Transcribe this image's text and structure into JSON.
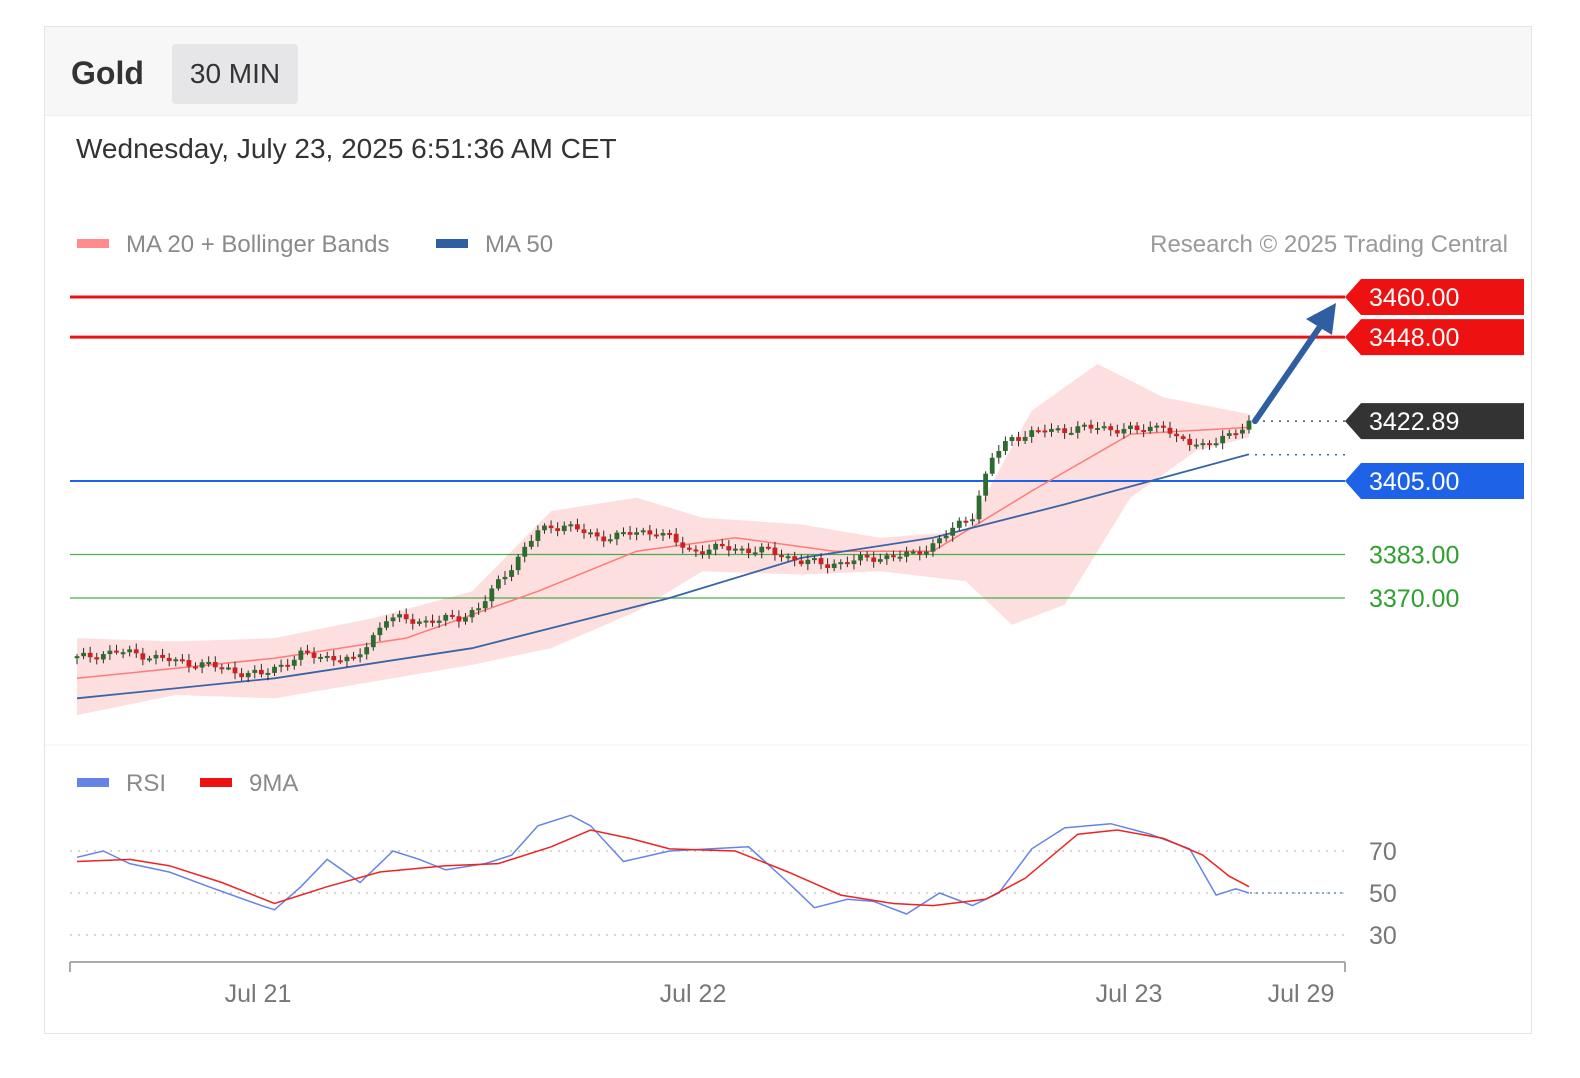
{
  "header": {
    "instrument": "Gold",
    "timeframe": "30 MIN",
    "datetime": "Wednesday, July 23, 2025 6:51:36 AM CET"
  },
  "legend": {
    "ma20_label": "MA 20 + Bollinger Bands",
    "ma50_label": "MA 50",
    "credit": "Research © 2025 Trading Central"
  },
  "rsi_legend": {
    "rsi_label": "RSI",
    "ma9_label": "9MA"
  },
  "colors": {
    "resistance": "#ee1111",
    "pivot": "#1e62e8",
    "support": "#2ea02e",
    "last": "#333333",
    "bullish": "#2e6b2e",
    "bearish": "#d11f1f",
    "ma20": "#ff7a7a",
    "bands": "#fdd9d9",
    "ma50": "#3a64a8",
    "rsi": "#6684e6",
    "rsi_ma": "#ee2222",
    "arrow": "#2f5ea1"
  },
  "chart_data": [
    {
      "type": "candlestick",
      "x_labels": [
        "Jul 21",
        "Jul 22",
        "Jul 23",
        "Jul 29"
      ],
      "ylim": [
        3345,
        3468
      ],
      "levels": [
        {
          "value": 3460.0,
          "label": "3460.00",
          "kind": "resistance"
        },
        {
          "value": 3448.0,
          "label": "3448.00",
          "kind": "resistance"
        },
        {
          "value": 3422.89,
          "label": "3422.89",
          "kind": "last"
        },
        {
          "value": 3405.0,
          "label": "3405.00",
          "kind": "pivot"
        },
        {
          "value": 3383.0,
          "label": "3383.00",
          "kind": "support"
        },
        {
          "value": 3370.0,
          "label": "3370.00",
          "kind": "support"
        }
      ],
      "close_path": [
        [
          0,
          3352
        ],
        [
          6,
          3354
        ],
        [
          10,
          3353
        ],
        [
          15,
          3351
        ],
        [
          20,
          3350
        ],
        [
          24,
          3348
        ],
        [
          28,
          3347
        ],
        [
          30,
          3349
        ],
        [
          34,
          3353
        ],
        [
          40,
          3352
        ],
        [
          42,
          3351
        ],
        [
          44,
          3356
        ],
        [
          47,
          3364
        ],
        [
          53,
          3363
        ],
        [
          58,
          3364
        ],
        [
          61,
          3367
        ],
        [
          65,
          3377
        ],
        [
          70,
          3390
        ],
        [
          74,
          3392
        ],
        [
          79,
          3388
        ],
        [
          83,
          3389
        ],
        [
          88,
          3390
        ],
        [
          90,
          3388
        ],
        [
          93,
          3384
        ],
        [
          98,
          3385
        ],
        [
          105,
          3384
        ],
        [
          110,
          3381
        ],
        [
          114,
          3380
        ],
        [
          121,
          3382
        ],
        [
          127,
          3383
        ],
        [
          130,
          3386
        ],
        [
          136,
          3395
        ],
        [
          139,
          3412
        ],
        [
          142,
          3418
        ],
        [
          147,
          3420
        ],
        [
          155,
          3421
        ],
        [
          161,
          3420
        ],
        [
          165,
          3422
        ],
        [
          167,
          3417
        ],
        [
          171,
          3416
        ],
        [
          175,
          3418
        ],
        [
          178,
          3422.89
        ]
      ],
      "ma20": [
        [
          0,
          3346
        ],
        [
          30,
          3352
        ],
        [
          50,
          3358
        ],
        [
          70,
          3372
        ],
        [
          85,
          3384
        ],
        [
          100,
          3388
        ],
        [
          115,
          3384
        ],
        [
          130,
          3384
        ],
        [
          145,
          3402
        ],
        [
          160,
          3419
        ],
        [
          178,
          3421
        ]
      ],
      "ma50": [
        [
          0,
          3340
        ],
        [
          30,
          3346
        ],
        [
          60,
          3355
        ],
        [
          90,
          3370
        ],
        [
          110,
          3382
        ],
        [
          130,
          3388
        ],
        [
          150,
          3398
        ],
        [
          178,
          3413
        ]
      ],
      "bands_upper": [
        [
          0,
          3358
        ],
        [
          15,
          3357
        ],
        [
          30,
          3358
        ],
        [
          45,
          3364
        ],
        [
          60,
          3372
        ],
        [
          72,
          3396
        ],
        [
          85,
          3400
        ],
        [
          95,
          3394
        ],
        [
          110,
          3392
        ],
        [
          122,
          3388
        ],
        [
          135,
          3390
        ],
        [
          145,
          3426
        ],
        [
          155,
          3440
        ],
        [
          165,
          3430
        ],
        [
          178,
          3425
        ]
      ],
      "bands_lower": [
        [
          0,
          3335
        ],
        [
          15,
          3341
        ],
        [
          30,
          3340
        ],
        [
          45,
          3345
        ],
        [
          60,
          3350
        ],
        [
          72,
          3355
        ],
        [
          85,
          3366
        ],
        [
          95,
          3378
        ],
        [
          110,
          3377
        ],
        [
          122,
          3378
        ],
        [
          135,
          3375
        ],
        [
          142,
          3362
        ],
        [
          150,
          3368
        ],
        [
          160,
          3400
        ],
        [
          170,
          3414
        ],
        [
          178,
          3418
        ]
      ],
      "projection": {
        "from": 3422.89,
        "to": 3460.0
      }
    },
    {
      "type": "line",
      "ylim": [
        20,
        90
      ],
      "ticks": [
        {
          "value": 70,
          "label": "70"
        },
        {
          "value": 50,
          "label": "50"
        },
        {
          "value": 30,
          "label": "30"
        }
      ],
      "series": [
        {
          "name": "RSI",
          "points": [
            [
              0,
              67
            ],
            [
              4,
              70
            ],
            [
              8,
              64
            ],
            [
              14,
              60
            ],
            [
              20,
              53
            ],
            [
              28,
              44
            ],
            [
              30,
              42
            ],
            [
              34,
              53
            ],
            [
              38,
              66
            ],
            [
              43,
              55
            ],
            [
              48,
              70
            ],
            [
              52,
              66
            ],
            [
              56,
              61
            ],
            [
              62,
              64
            ],
            [
              66,
              68
            ],
            [
              70,
              82
            ],
            [
              75,
              87
            ],
            [
              78,
              82
            ],
            [
              83,
              65
            ],
            [
              90,
              70
            ],
            [
              96,
              71
            ],
            [
              102,
              72
            ],
            [
              108,
              55
            ],
            [
              112,
              43
            ],
            [
              117,
              47
            ],
            [
              121,
              46
            ],
            [
              126,
              40
            ],
            [
              131,
              50
            ],
            [
              136,
              44
            ],
            [
              140,
              50
            ],
            [
              145,
              71
            ],
            [
              150,
              81
            ],
            [
              157,
              83
            ],
            [
              163,
              78
            ],
            [
              169,
              71
            ],
            [
              173,
              49
            ],
            [
              176,
              52
            ],
            [
              178,
              50
            ]
          ]
        },
        {
          "name": "9MA",
          "points": [
            [
              0,
              65
            ],
            [
              8,
              66
            ],
            [
              14,
              63
            ],
            [
              22,
              55
            ],
            [
              30,
              45
            ],
            [
              38,
              53
            ],
            [
              46,
              60
            ],
            [
              56,
              63
            ],
            [
              64,
              64
            ],
            [
              72,
              72
            ],
            [
              78,
              80
            ],
            [
              84,
              76
            ],
            [
              90,
              71
            ],
            [
              100,
              70
            ],
            [
              108,
              60
            ],
            [
              116,
              49
            ],
            [
              124,
              45
            ],
            [
              130,
              44
            ],
            [
              138,
              47
            ],
            [
              144,
              57
            ],
            [
              152,
              78
            ],
            [
              158,
              80
            ],
            [
              165,
              76
            ],
            [
              171,
              68
            ],
            [
              175,
              58
            ],
            [
              178,
              53
            ]
          ]
        }
      ]
    }
  ]
}
